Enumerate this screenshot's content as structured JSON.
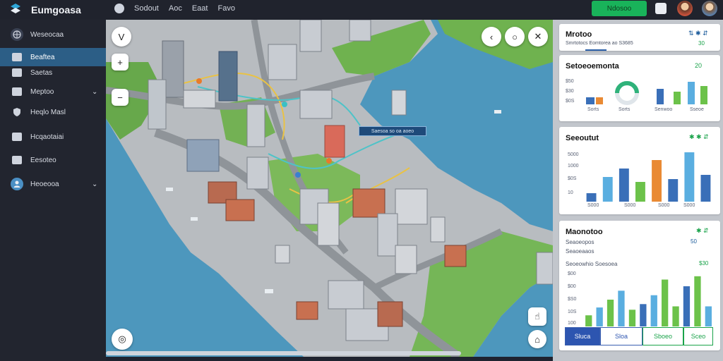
{
  "app": {
    "brand": "Eumgoasa",
    "nav": [
      "Sodout",
      "Aoc",
      "Eaat",
      "Favo"
    ],
    "cta_label": "Ndosoo",
    "accent": "#19b35a"
  },
  "sidebar": {
    "items": [
      {
        "label": "Weseocaa",
        "icon": "globe-icon",
        "active": false
      },
      {
        "label": "Beaftea",
        "icon": "folder-icon",
        "active": true
      },
      {
        "label": "Saetas",
        "icon": "layers-icon",
        "active": false
      },
      {
        "label": "Meptoo",
        "icon": "briefcase-icon",
        "active": false,
        "chevron": true
      },
      {
        "label": "Heqlo Masl",
        "icon": "shield-icon",
        "active": false
      },
      {
        "label": "Hcqaotaiai",
        "icon": "grid-icon",
        "active": false
      },
      {
        "label": "Eesoteo",
        "icon": "users-icon",
        "active": false
      },
      {
        "label": "Heoeooa",
        "icon": "user-icon",
        "active": false,
        "chevron": true
      }
    ]
  },
  "map": {
    "tooltip": "Saesoa so oa aoeo",
    "controls": {
      "top_left_1": "V",
      "zoom_in": "+",
      "zoom_out": "−",
      "top_right_back": "‹",
      "top_right_chat": "○",
      "top_right_tools": "✕",
      "bottom_left": "◎",
      "bottom_right_1": "☝",
      "bottom_right_2": "⌂"
    }
  },
  "panel": {
    "card1": {
      "title": "Mrotoo",
      "subtitle": "Smrtotocs Eomtorea ao S3685",
      "score": "30"
    },
    "card2": {
      "title": "Setoeoemonta",
      "badge": "20",
      "ticks": [
        "$50",
        "$30",
        "$0S"
      ],
      "labels": [
        "Sorts",
        "Sorts",
        "Senwoo",
        "Sseoe"
      ],
      "chart_data": {
        "type": "bar",
        "categories": [
          "Sorts",
          "Sorts",
          "Senwoo",
          "Sseoe"
        ],
        "values": [
          6,
          11,
          16,
          22
        ]
      }
    },
    "card3": {
      "title": "Seeoutut",
      "ticks": [
        "5000",
        "1000",
        "$0S",
        "10"
      ],
      "labels": [
        "S000",
        "S000",
        "S000",
        "S000"
      ],
      "chart_data": {
        "type": "bar",
        "categories": [
          "S000",
          "S000",
          "S000",
          "S000"
        ],
        "values": [
          12,
          35,
          47,
          28,
          59,
          32,
          70,
          38
        ]
      }
    },
    "card4": {
      "title": "Maonotoo",
      "sub1": "Seaoeopos",
      "sub2": "Seaoeaaos",
      "sub3": "Seoeowhio Soesoea",
      "val1": "50",
      "val2": "$30",
      "ticks": [
        "$00",
        "$00",
        "$S0",
        "10S",
        "100"
      ],
      "chart_data": {
        "type": "bar",
        "values": [
          10,
          17,
          24,
          32,
          15,
          20,
          28,
          42,
          18,
          36,
          45,
          18
        ]
      }
    },
    "tabs": [
      "Sluca",
      "Sloa",
      "Sboeo",
      "Sceo"
    ]
  }
}
